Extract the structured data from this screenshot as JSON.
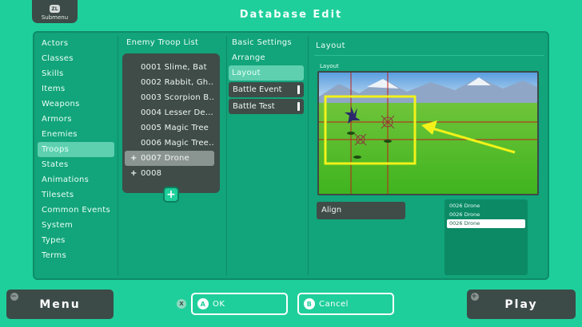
{
  "header": {
    "title": "Database Edit",
    "submenu_badge": "ZL",
    "submenu_label": "Submenu"
  },
  "database_categories": [
    {
      "label": "Actors"
    },
    {
      "label": "Classes"
    },
    {
      "label": "Skills"
    },
    {
      "label": "Items"
    },
    {
      "label": "Weapons"
    },
    {
      "label": "Armors"
    },
    {
      "label": "Enemies"
    },
    {
      "label": "Troops",
      "active": true
    },
    {
      "label": "States"
    },
    {
      "label": "Animations"
    },
    {
      "label": "Tilesets"
    },
    {
      "label": "Common Events"
    },
    {
      "label": "System"
    },
    {
      "label": "Types"
    },
    {
      "label": "Terms"
    }
  ],
  "troop_list": {
    "title": "Enemy Troop List",
    "items": [
      {
        "label": "0001 Slime, Bat"
      },
      {
        "label": "0002 Rabbit, Gh…"
      },
      {
        "label": "0003 Scorpion B…"
      },
      {
        "label": "0004 Lesser De…"
      },
      {
        "label": "0005 Magic Tree"
      },
      {
        "label": "0006 Magic Tree…"
      },
      {
        "label": "0007 Drone",
        "selected": true,
        "prefix": "+"
      },
      {
        "label": "0008",
        "prefix": "+"
      }
    ],
    "add_icon": "+"
  },
  "settings": {
    "items": [
      "Basic Settings",
      "Arrange",
      "Layout"
    ],
    "active": "Layout",
    "buttons": [
      "Battle Event",
      "Battle Test"
    ]
  },
  "layout_panel": {
    "title": "Layout",
    "sub_label": "Layout",
    "align_label": "Align",
    "units": [
      {
        "label": "0026 Drone"
      },
      {
        "label": "0026 Drone"
      },
      {
        "label": "0026 Drone",
        "selected": true
      }
    ]
  },
  "footer": {
    "menu_label": "Menu",
    "menu_icon": "−",
    "play_label": "Play",
    "play_icon": "+",
    "x_badge": "X",
    "ok_badge": "A",
    "ok_label": "OK",
    "cancel_badge": "B",
    "cancel_label": "Cancel"
  },
  "colors": {
    "background": "#1fcf9b",
    "panel": "#12a47a",
    "dark_button": "#3c4b47",
    "highlight": "#5ed0b0",
    "selection_frame": "#f2f21a",
    "crosshair": "#c0201a"
  }
}
